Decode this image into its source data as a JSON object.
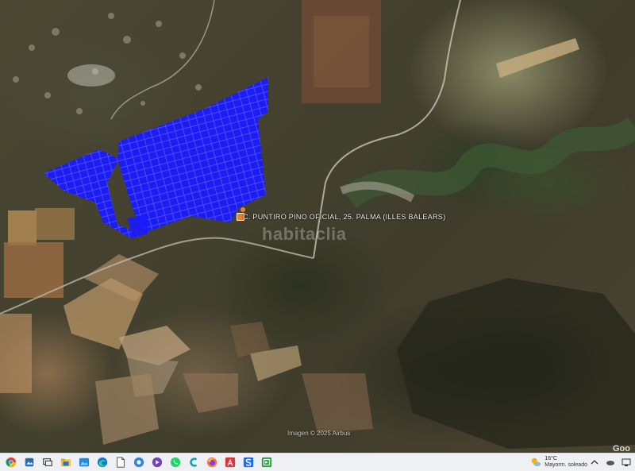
{
  "map": {
    "location_label": "C. PUNTIRO PINO OFICIAL, 25. PALMA (ILLES BALEARS)",
    "watermark": "habitaclia",
    "attribution": "Imagen © 2025 Airbus",
    "provider": "Goo",
    "parcel_color": "#1a1aff"
  },
  "taskbar": {
    "apps": [
      {
        "name": "chrome-icon"
      },
      {
        "name": "image-editor-icon"
      },
      {
        "name": "task-view-icon"
      },
      {
        "name": "file-explorer-icon"
      },
      {
        "name": "photos-icon"
      },
      {
        "name": "edge-icon"
      },
      {
        "name": "document-icon"
      },
      {
        "name": "photos-viewer-icon"
      },
      {
        "name": "sound-icon"
      },
      {
        "name": "whatsapp-icon"
      },
      {
        "name": "app-c-icon"
      },
      {
        "name": "firefox-icon"
      },
      {
        "name": "acrobat-icon"
      },
      {
        "name": "app-s-icon"
      },
      {
        "name": "app-green-icon"
      }
    ],
    "weather_temp": "16°C",
    "weather_desc": "Mayorm. soleado",
    "colors": {
      "accent": "#0078d4"
    }
  }
}
